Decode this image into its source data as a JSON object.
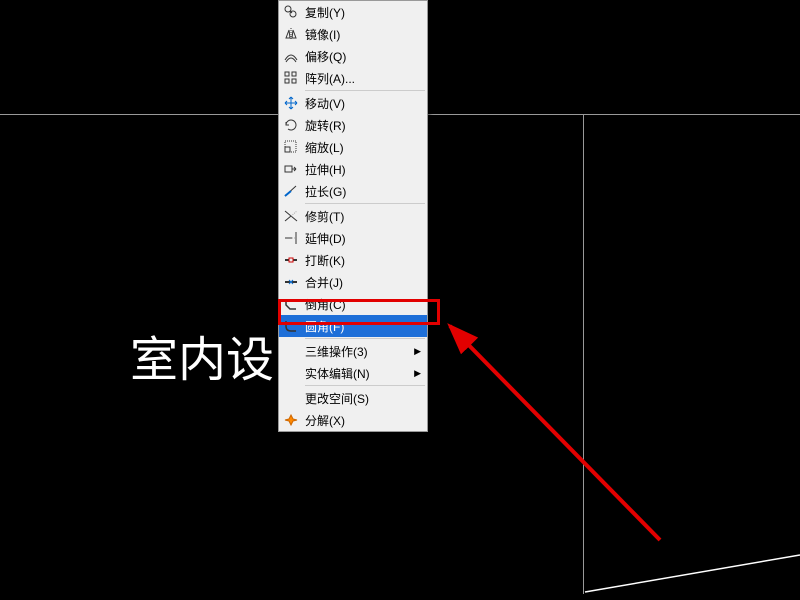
{
  "background_text": "室内设",
  "highlighted_index": 13,
  "menu": {
    "groups": [
      [
        {
          "icon": "copy-icon",
          "label": "复制(Y)"
        },
        {
          "icon": "mirror-icon",
          "label": "镜像(I)"
        },
        {
          "icon": "offset-icon",
          "label": "偏移(Q)"
        },
        {
          "icon": "array-icon",
          "label": "阵列(A)..."
        }
      ],
      [
        {
          "icon": "move-icon",
          "label": "移动(V)"
        },
        {
          "icon": "rotate-icon",
          "label": "旋转(R)"
        },
        {
          "icon": "scale-icon",
          "label": "缩放(L)"
        },
        {
          "icon": "stretch-icon",
          "label": "拉伸(H)"
        },
        {
          "icon": "lengthen-icon",
          "label": "拉长(G)"
        }
      ],
      [
        {
          "icon": "trim-icon",
          "label": "修剪(T)"
        },
        {
          "icon": "extend-icon",
          "label": "延伸(D)"
        },
        {
          "icon": "break-icon",
          "label": "打断(K)"
        },
        {
          "icon": "join-icon",
          "label": "合并(J)"
        },
        {
          "icon": "chamfer-icon",
          "label": "倒角(C)"
        },
        {
          "icon": "fillet-icon",
          "label": "圆角(F)",
          "highlighted": true
        }
      ],
      [
        {
          "icon": "3dops-icon",
          "label": "三维操作(3)",
          "submenu": true
        },
        {
          "icon": "solidedit-icon",
          "label": "实体编辑(N)",
          "submenu": true
        }
      ],
      [
        {
          "icon": "changespace-icon",
          "label": "更改空间(S)"
        },
        {
          "icon": "explode-icon",
          "label": "分解(X)"
        }
      ]
    ]
  }
}
